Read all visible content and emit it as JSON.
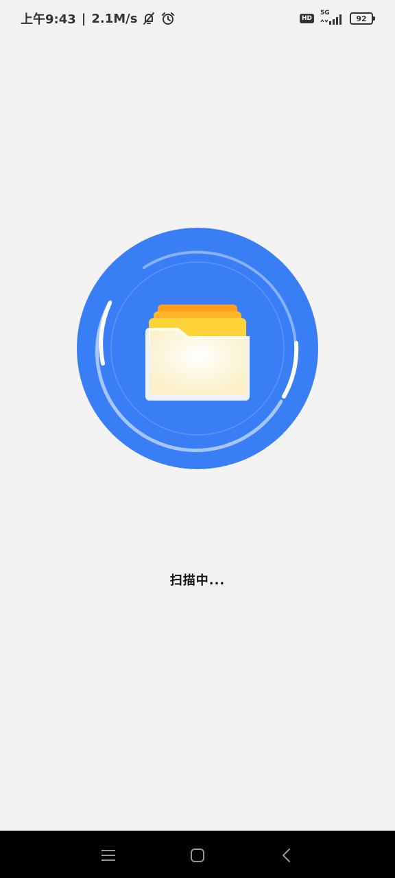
{
  "status_bar": {
    "time": "上午9:43",
    "separator": "|",
    "speed": "2.1M/s",
    "hd": "HD",
    "network": "5G",
    "battery": "92"
  },
  "main": {
    "scan_text": "扫描中..."
  },
  "icons": {
    "mute": "bell-slash-icon",
    "alarm": "alarm-clock-icon",
    "signal": "signal-icon",
    "folder": "folder-icon",
    "menu": "menu-icon",
    "home": "home-icon",
    "back": "back-icon"
  },
  "colors": {
    "background": "#f2f2f2",
    "circle_blue": "#3a7ef5",
    "folder_yellow": "#ffd33a",
    "folder_orange": "#ff9f1a",
    "nav_bar": "#000000"
  }
}
